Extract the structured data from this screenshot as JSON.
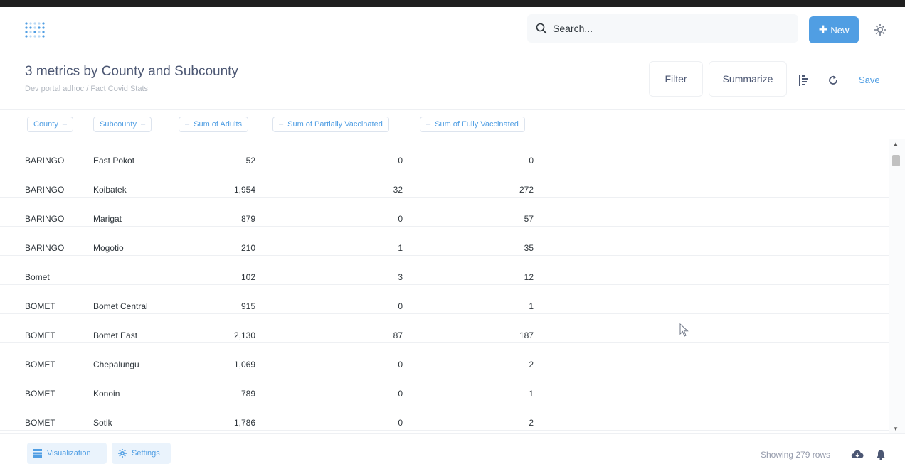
{
  "navbar": {
    "logo_icon": "metabase-logo",
    "search_placeholder": "Search...",
    "new_label": "New",
    "settings_icon": "gear-icon"
  },
  "header": {
    "title": "3 metrics by County and Subcounty",
    "breadcrumb": "Dev portal adhoc / Fact Covid Stats",
    "filter_label": "Filter",
    "summarize_label": "Summarize",
    "save_label": "Save"
  },
  "columns": [
    "County",
    "Subcounty",
    "Sum of Adults",
    "Sum of Partially Vaccinated",
    "Sum of Fully Vaccinated"
  ],
  "rows": [
    [
      "BARINGO",
      "East Pokot",
      "52",
      "0",
      "0"
    ],
    [
      "BARINGO",
      "Koibatek",
      "1,954",
      "32",
      "272"
    ],
    [
      "BARINGO",
      "Marigat",
      "879",
      "0",
      "57"
    ],
    [
      "BARINGO",
      "Mogotio",
      "210",
      "1",
      "35"
    ],
    [
      "Bomet",
      "",
      "102",
      "3",
      "12"
    ],
    [
      "BOMET",
      "Bomet Central",
      "915",
      "0",
      "1"
    ],
    [
      "BOMET",
      "Bomet East",
      "2,130",
      "87",
      "187"
    ],
    [
      "BOMET",
      "Chepalungu",
      "1,069",
      "0",
      "2"
    ],
    [
      "BOMET",
      "Konoin",
      "789",
      "0",
      "1"
    ],
    [
      "BOMET",
      "Sotik",
      "1,786",
      "0",
      "2"
    ]
  ],
  "footer": {
    "visualization_label": "Visualization",
    "settings_label": "Settings",
    "row_count": "Showing 279 rows"
  },
  "colors": {
    "accent": "#509ee3",
    "text": "#4c5773",
    "muted": "#949aab"
  }
}
